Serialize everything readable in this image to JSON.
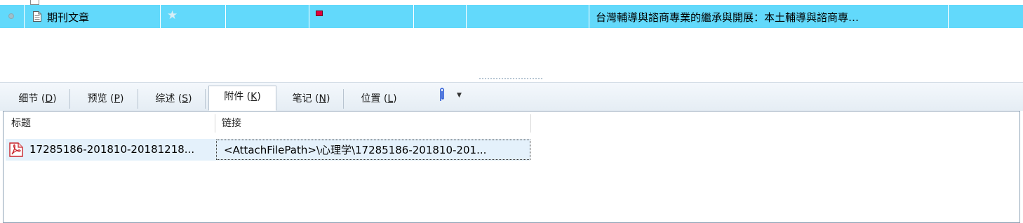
{
  "record_list": {
    "selected_row": {
      "type_label": "期刊文章",
      "title": "台灣輔導與諮商專業的繼承與開展：本土輔導與諮商專…",
      "status_icon": "status-dot-icon",
      "doc_icon": "document-icon",
      "rating_icon": "star-icon",
      "flag_icon": "red-flag-icon",
      "colors": {
        "highlight": "#62d9fb",
        "flag": "#e0003a"
      }
    }
  },
  "tabs": [
    {
      "label": "细节 (",
      "key": "D",
      "suffix": ")"
    },
    {
      "label": "预览 (",
      "key": "P",
      "suffix": ")"
    },
    {
      "label": "综述 (",
      "key": "S",
      "suffix": ")"
    },
    {
      "label": "附件 (",
      "key": "K",
      "suffix": ")",
      "active": true
    },
    {
      "label": "笔记 (",
      "key": "N",
      "suffix": ")"
    },
    {
      "label": "位置 (",
      "key": "L",
      "suffix": ")"
    }
  ],
  "attachment_menu_icon": "paperclip-icon",
  "attachments": {
    "columns": [
      "标题",
      "链接"
    ],
    "rows": [
      {
        "icon": "pdf-icon",
        "title": "17285186-201810-20181218...",
        "link": "<AttachFilePath>\\心理学\\17285186-201810-201..."
      }
    ]
  }
}
